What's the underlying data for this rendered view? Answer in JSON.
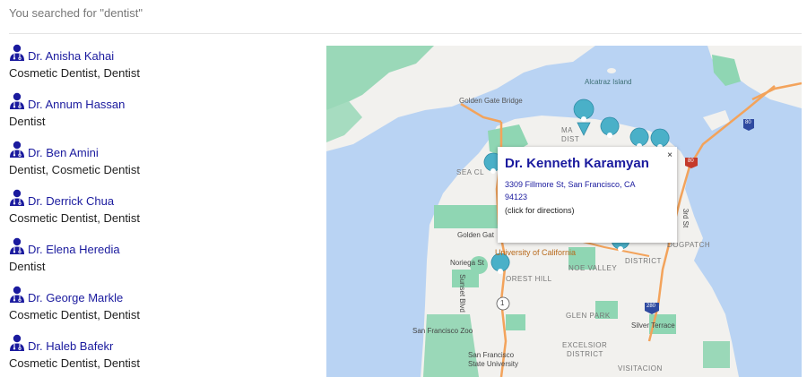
{
  "search": {
    "summary": "You searched for \"dentist\""
  },
  "results": [
    {
      "name": "Dr. Anisha Kahai",
      "specialties": "Cosmetic Dentist, Dentist"
    },
    {
      "name": "Dr. Annum Hassan",
      "specialties": "Dentist"
    },
    {
      "name": "Dr. Ben Amini",
      "specialties": "Dentist, Cosmetic Dentist"
    },
    {
      "name": "Dr. Derrick Chua",
      "specialties": "Cosmetic Dentist, Dentist"
    },
    {
      "name": "Dr. Elena Heredia",
      "specialties": "Dentist"
    },
    {
      "name": "Dr. George Markle",
      "specialties": "Cosmetic Dentist, Dentist"
    },
    {
      "name": "Dr. Haleb Bafekr",
      "specialties": "Cosmetic Dentist, Dentist"
    }
  ],
  "map": {
    "popup": {
      "title": "Dr. Kenneth Karamyan",
      "address": "3309 Fillmore St, San Francisco, CA 94123",
      "hint": "(click for directions)",
      "close": "×"
    },
    "labels": {
      "alcatraz": "Alcatraz Island",
      "golden_gate_bridge": "Golden Gate Bridge",
      "marina_1": "MA",
      "marina_2": "DIST",
      "sea_cliff": "SEA CL",
      "golden_gate": "Golden Gat",
      "university": "University of California",
      "noriega": "Noriega St",
      "forest_hill": "OREST HILL",
      "noe_valley": "NOE VALLEY",
      "district": "DISTRICT",
      "dogpatch": "DOGPATCH",
      "third_st": "3rd St",
      "sunset_blvd": "Sunset Blvd",
      "glen_park": "GLEN PARK",
      "silver_terrace": "Silver Terrace",
      "sf_zoo": "San Francisco Zoo",
      "sfsu_1": "San Francisco",
      "sfsu_2": "State University",
      "excelsior_1": "EXCELSIOR",
      "excelsior_2": "DISTRICT",
      "visitacion": "VISITACION",
      "route_1": "1",
      "route_280": "280",
      "route_80": "80",
      "route_80b": "80"
    },
    "colors": {
      "water": "#b9d3f3",
      "land": "#f2f1ee",
      "park": "#8fd6b3",
      "highway": "#f3a35b",
      "pin": "#4ab0c8",
      "link": "#1a1a9e"
    }
  }
}
